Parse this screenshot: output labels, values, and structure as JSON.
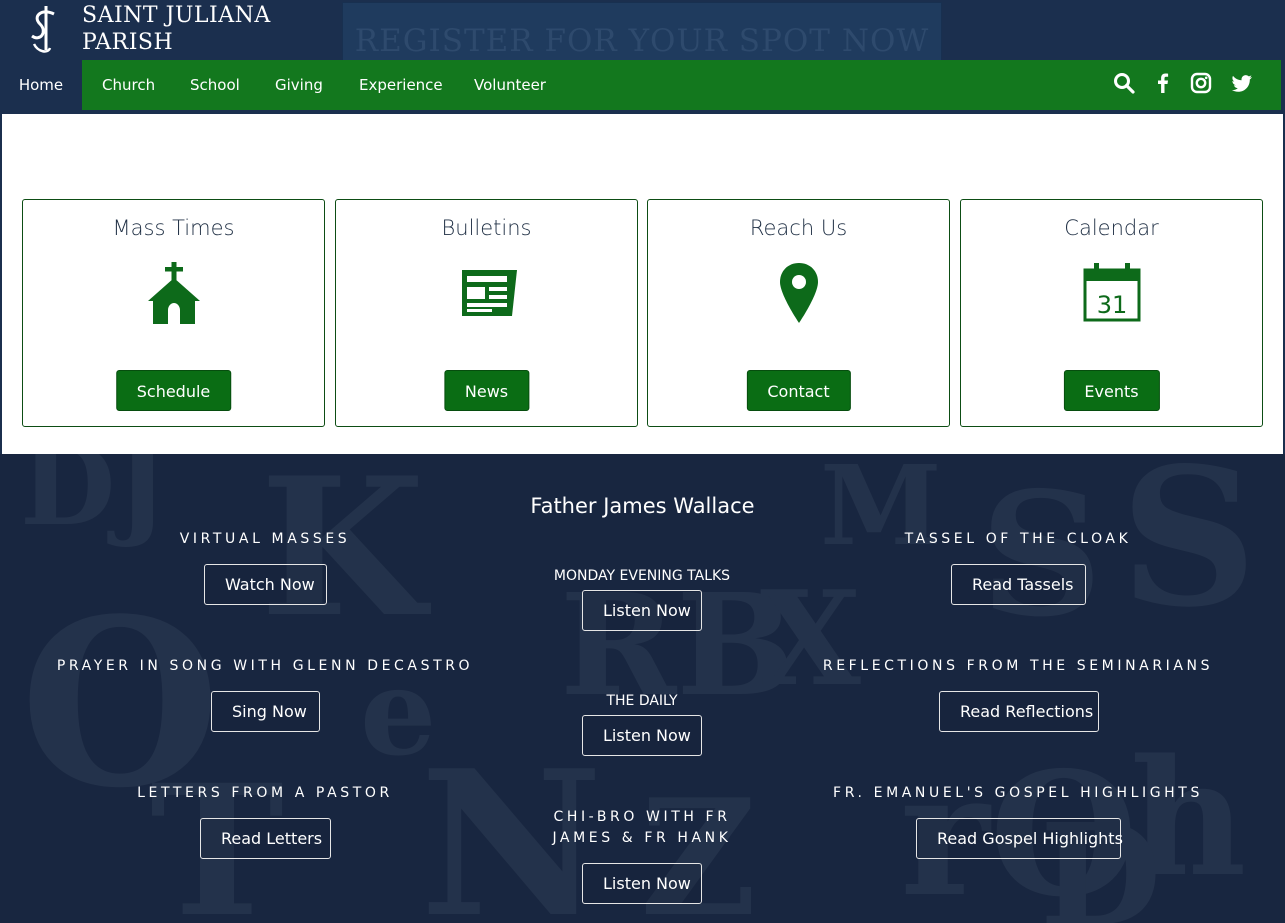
{
  "header": {
    "brand_line1": "SAINT JULIANA",
    "brand_line2": "PARISH",
    "banner_text": "REGISTER FOR YOUR SPOT NOW"
  },
  "nav": {
    "items": [
      "Home",
      "Church",
      "School",
      "Giving",
      "Experience",
      "Volunteer"
    ],
    "icons": [
      "search-icon",
      "facebook-icon",
      "instagram-icon",
      "twitter-icon"
    ]
  },
  "cards": [
    {
      "title": "Mass Times",
      "icon": "church-icon",
      "button": "Schedule"
    },
    {
      "title": "Bulletins",
      "icon": "newspaper-icon",
      "button": "News"
    },
    {
      "title": "Reach Us",
      "icon": "map-pin-icon",
      "button": "Contact"
    },
    {
      "title": "Calendar",
      "icon": "calendar-icon",
      "button": "Events",
      "calendar_day": "31"
    }
  ],
  "father": {
    "title": "Father James Wallace",
    "left": [
      {
        "label": "VIRTUAL MASSES",
        "button": "Watch Now"
      },
      {
        "label": "PRAYER IN SONG WITH GLENN DECASTRO",
        "button": "Sing Now"
      },
      {
        "label": "LETTERS FROM A PASTOR",
        "button": "Read Letters"
      }
    ],
    "middle": [
      {
        "label": "MONDAY EVENING TALKS",
        "button": "Listen Now"
      },
      {
        "label": "THE DAILY",
        "button": "Listen Now"
      },
      {
        "label_line1": "CHI-BRO WITH FR",
        "label_line2": "JAMES & FR HANK",
        "button": "Listen Now"
      }
    ],
    "right": [
      {
        "label": "TASSEL OF THE CLOAK",
        "button": "Read Tassels"
      },
      {
        "label": "REFLECTIONS FROM THE SEMINARIANS",
        "button": "Read Reflections"
      },
      {
        "label": "FR. EMANUEL'S GOSPEL HIGHLIGHTS",
        "button": "Read Gospel Highlights"
      }
    ]
  },
  "colors": {
    "navy": "#1b2f4e",
    "green": "#13781e",
    "button_green": "#0a6d14",
    "icon_green": "#0d6a1a"
  }
}
